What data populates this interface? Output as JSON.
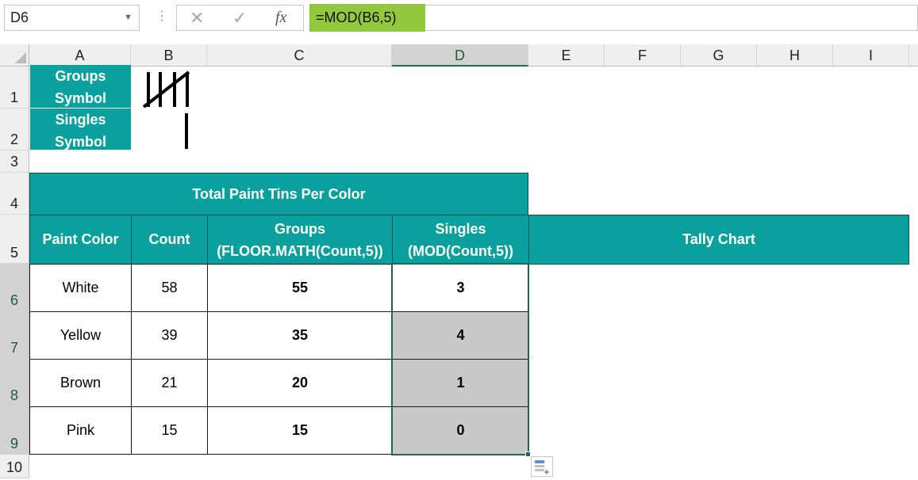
{
  "name_box": {
    "value": "D6"
  },
  "formula_bar": {
    "cancel_glyph": "✕",
    "enter_glyph": "✓",
    "fx_glyph": "fx",
    "formula": "=MOD(B6,5)"
  },
  "columns": [
    "A",
    "B",
    "C",
    "D",
    "E",
    "F",
    "G",
    "H",
    "I"
  ],
  "rows": [
    "1",
    "2",
    "3",
    "4",
    "5",
    "6",
    "7",
    "8",
    "9",
    "10"
  ],
  "legend": {
    "groups_line1": "Groups",
    "groups_line2": "Symbol",
    "singles_line1": "Singles",
    "singles_line2": "Symbol"
  },
  "table": {
    "title": "Total Paint Tins Per Color",
    "headers": {
      "paint_color": "Paint Color",
      "count": "Count",
      "groups_line1": "Groups",
      "groups_line2": "(FLOOR.MATH(Count,5))",
      "singles_line1": "Singles",
      "singles_line2": "(MOD(Count,5))",
      "tally": "Tally Chart"
    },
    "rows": [
      {
        "color": "White",
        "count": "58",
        "groups": "55",
        "singles": "3"
      },
      {
        "color": "Yellow",
        "count": "39",
        "groups": "35",
        "singles": "4"
      },
      {
        "color": "Brown",
        "count": "21",
        "groups": "20",
        "singles": "1"
      },
      {
        "color": "Pink",
        "count": "15",
        "groups": "15",
        "singles": "0"
      }
    ]
  },
  "colors": {
    "teal": "#0aa09e",
    "formula_highlight": "#92c83e",
    "selection": "#217346"
  }
}
